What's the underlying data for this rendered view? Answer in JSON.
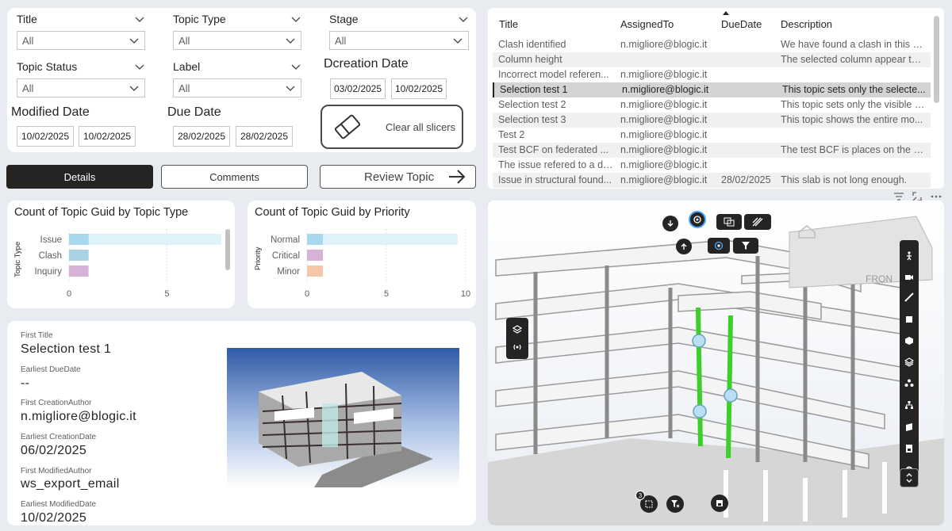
{
  "filters": {
    "title": {
      "label": "Title",
      "value": "All"
    },
    "topic_type": {
      "label": "Topic Type",
      "value": "All"
    },
    "stage": {
      "label": "Stage",
      "value": "All"
    },
    "topic_status": {
      "label": "Topic Status",
      "value": "All"
    },
    "label": {
      "label": "Label",
      "value": "All"
    },
    "creation_date": {
      "label": "Dcreation Date",
      "from": "03/02/2025",
      "to": "10/02/2025"
    },
    "modified_date": {
      "label": "Modified Date",
      "from": "10/02/2025",
      "to": "10/02/2025"
    },
    "due_date": {
      "label": "Due Date",
      "from": "28/02/2025",
      "to": "28/02/2025"
    },
    "clear_label": "Clear all slicers"
  },
  "nav": {
    "details": "Details",
    "comments": "Comments",
    "review": "Review Topic"
  },
  "table": {
    "headers": [
      "Title",
      "AssignedTo",
      "DueDate",
      "Description"
    ],
    "rows": [
      {
        "title": "Clash identified",
        "assigned": "n.migliore@blogic.it",
        "due": "",
        "desc": "We have found a clash in this p..."
      },
      {
        "title": "Column height",
        "assigned": "",
        "due": "",
        "desc": "The selected column appear to..."
      },
      {
        "title": "Incorrect model referen...",
        "assigned": "n.migliore@blogic.it",
        "due": "",
        "desc": ""
      },
      {
        "title": "Selection test 1",
        "assigned": "n.migliore@blogic.it",
        "due": "",
        "desc": "This topic sets only the selecte..."
      },
      {
        "title": "Selection test 2",
        "assigned": "n.migliore@blogic.it",
        "due": "",
        "desc": "This topic sets only the visible i..."
      },
      {
        "title": "Selection test 3",
        "assigned": "n.migliore@blogic.it",
        "due": "",
        "desc": "This topic shows the entire mo..."
      },
      {
        "title": "Test 2",
        "assigned": "n.migliore@blogic.it",
        "due": "",
        "desc": ""
      },
      {
        "title": "Test BCF on federated ...",
        "assigned": "n.migliore@blogic.it",
        "due": "",
        "desc": "The test BCF is places on the R..."
      },
      {
        "title": "The issue refered to a di...",
        "assigned": "n.migliore@blogic.it",
        "due": "",
        "desc": ""
      },
      {
        "title": "Issue in structural found...",
        "assigned": "n.migliore@blogic.it",
        "due": "28/02/2025",
        "desc": "This slab is not long enough."
      }
    ]
  },
  "chart_data": [
    {
      "type": "bar",
      "title": "Count of Topic Guid by Topic Type",
      "ylabel": "Topic Type",
      "categories": [
        "Issue",
        "Clash",
        "Inquiry"
      ],
      "values": [
        1,
        1,
        1
      ],
      "colors": [
        "#a7d8ee",
        "#a9d3e4",
        "#d6b3d6"
      ],
      "xlim": [
        0,
        7.7
      ],
      "ticks": [
        0,
        5
      ]
    },
    {
      "type": "bar",
      "title": "Count of Topic Guid by Priority",
      "ylabel": "Priority",
      "categories": [
        "Normal",
        "Critical",
        "Minor"
      ],
      "values": [
        1,
        1,
        1
      ],
      "colors": [
        "#a7d8ee",
        "#d6b3d6",
        "#f7c5a8"
      ],
      "xlim": [
        0,
        10
      ],
      "ticks": [
        0,
        5,
        10
      ]
    }
  ],
  "info": {
    "first_title_lbl": "First Title",
    "first_title": "Selection test 1",
    "due_lbl": "Earliest DueDate",
    "due": "--",
    "author_lbl": "First CreationAuthor",
    "author": "n.migliore@blogic.it",
    "creation_lbl": "Earliest CreationDate",
    "creation": "06/02/2025",
    "mod_author_lbl": "First ModifiedAuthor",
    "mod_author": "ws_export_email",
    "mod_date_lbl": "Earliest ModifiedDate",
    "mod_date": "10/02/2025"
  },
  "viewer": {
    "badge_count": "3",
    "front_label": "FRON",
    "accent_green": "#3ccf2a"
  }
}
